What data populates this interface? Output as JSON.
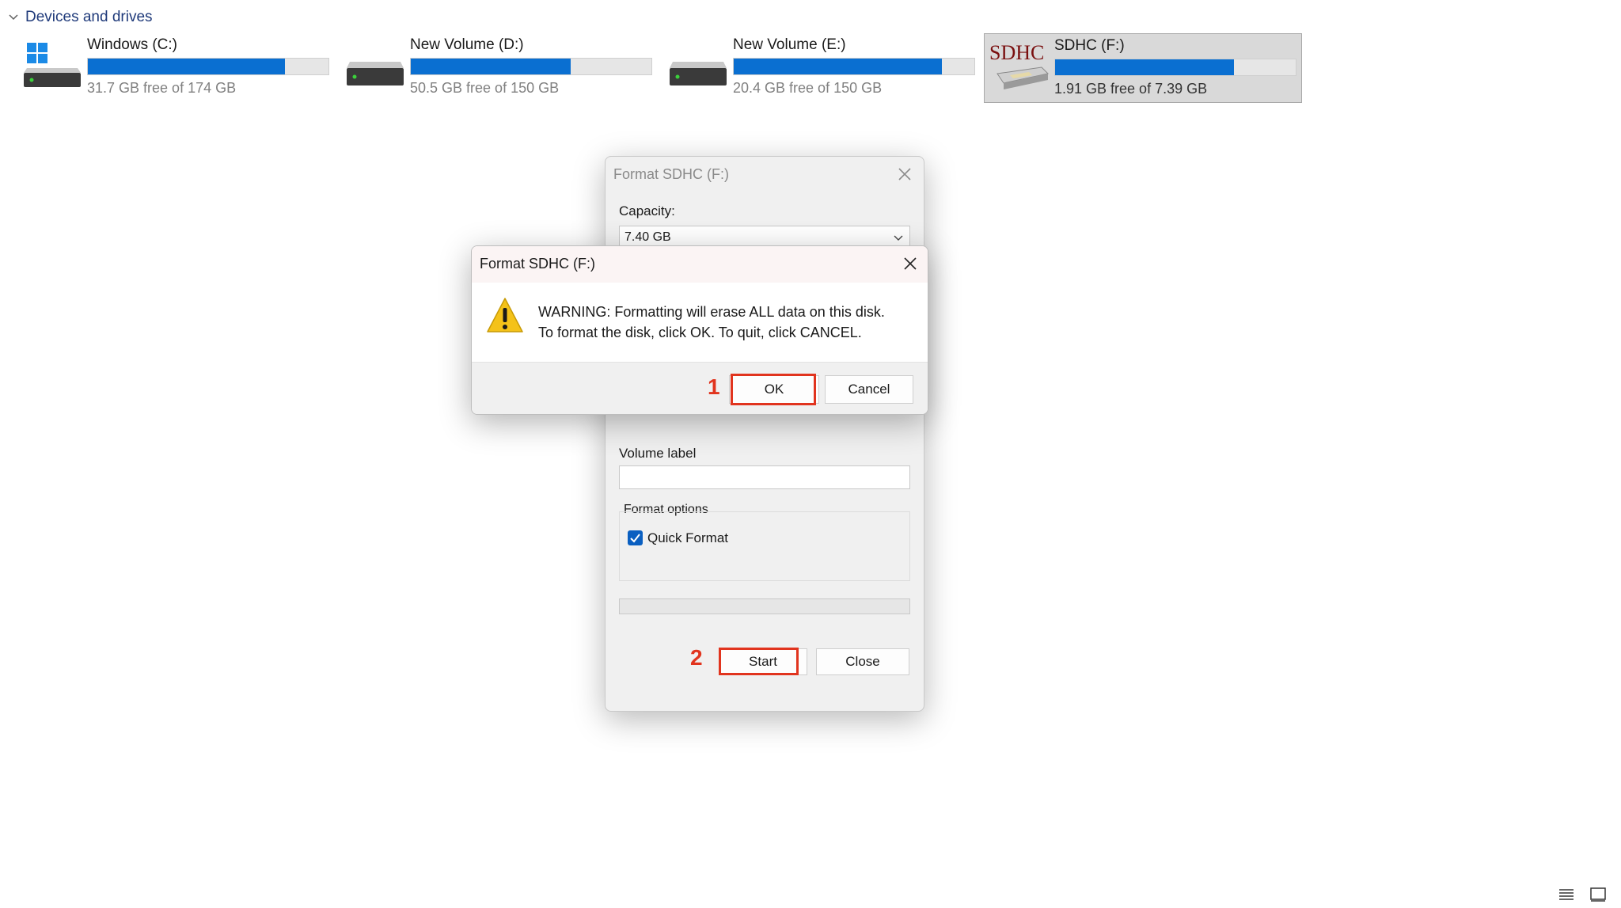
{
  "section": {
    "title": "Devices and drives"
  },
  "drives": [
    {
      "name": "Windows (C:)",
      "free_text": "31.7 GB free of 174 GB",
      "used_fraction": 0.818,
      "icon": "windows-drive-icon"
    },
    {
      "name": "New Volume (D:)",
      "free_text": "50.5 GB free of 150 GB",
      "used_fraction": 0.663,
      "icon": "hard-drive-icon"
    },
    {
      "name": "New Volume (E:)",
      "free_text": "20.4 GB free of 150 GB",
      "used_fraction": 0.864,
      "icon": "hard-drive-icon"
    },
    {
      "name": "SDHC (F:)",
      "free_text": "1.91 GB free of 7.39 GB",
      "used_fraction": 0.742,
      "icon": "sdhc-card-icon",
      "icon_text": "SDHC",
      "selected": true
    }
  ],
  "format_dialog": {
    "title": "Format SDHC (F:)",
    "capacity_label": "Capacity:",
    "capacity_value": "7.40 GB",
    "volume_label": "Volume label",
    "volume_value": "",
    "format_options_label": "Format options",
    "quick_format_label": "Quick Format",
    "quick_format_checked": true,
    "start_label": "Start",
    "close_label": "Close"
  },
  "warning_dialog": {
    "title": "Format SDHC (F:)",
    "message_line1": "WARNING: Formatting will erase ALL data on this disk.",
    "message_line2": "To format the disk, click OK. To quit, click CANCEL.",
    "ok_label": "OK",
    "cancel_label": "Cancel"
  },
  "annotations": {
    "step1": "1",
    "step2": "2",
    "color": "#e1341e"
  },
  "colors": {
    "accent": "#0a6fd1",
    "header": "#1f3a7a"
  }
}
